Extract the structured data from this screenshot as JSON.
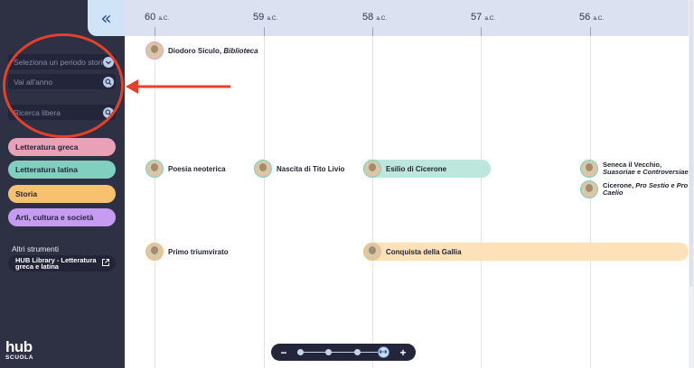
{
  "sidebar": {
    "collapse_icon": "double-chevron-left-icon",
    "period_select": {
      "placeholder": "Seleziona un periodo storico",
      "icon": "chevron-down-icon"
    },
    "year_input": {
      "placeholder": "Vai all'anno",
      "icon": "search-icon"
    },
    "free_search": {
      "placeholder": "Ricerca libera",
      "icon": "search-icon"
    },
    "categories": [
      {
        "label": "Letteratura greca",
        "color": "#e8a1b7"
      },
      {
        "label": "Letteratura latina",
        "color": "#7fd0bf"
      },
      {
        "label": "Storia",
        "color": "#f7c270"
      },
      {
        "label": "Arti, cultura e società",
        "color": "#c79bf1"
      }
    ],
    "tools_label": "Altri strumenti",
    "hub_link": {
      "label": "HUB Library - Letteratura greca e latina",
      "icon": "external-link-icon"
    },
    "logo": {
      "main": "hub",
      "sub": "SCUOLA"
    }
  },
  "timeline": {
    "years": [
      {
        "value": "60",
        "era": "a.C."
      },
      {
        "value": "59",
        "era": "a.C."
      },
      {
        "value": "58",
        "era": "a.C."
      },
      {
        "value": "57",
        "era": "a.C."
      },
      {
        "value": "56",
        "era": "a.C."
      }
    ],
    "events": {
      "diodoro": {
        "author": "Diodoro Siculo, ",
        "work": "Biblioteca"
      },
      "poesia": "Poesia neoterica",
      "tito_livio": "Nascita di Tito Livio",
      "esilio": "Esilio di Cicerone",
      "seneca": {
        "author": "Seneca il Vecchio, ",
        "work1": "Suasoriae",
        "mid": " e ",
        "work2": "Controversiae"
      },
      "cicerone": {
        "author": "Cicerone, ",
        "work1": "Pro Sestio",
        "mid": " e ",
        "work2": "Pro Caelio"
      },
      "triumvirato": "Primo triumvirato",
      "gallia": "Conquista della Gallia"
    },
    "colors": {
      "latina_bar": "#bde6dc",
      "storia_bar": "#fde1b9"
    }
  },
  "zoom": {
    "minus": "−",
    "plus": "+",
    "handle_icon": "resize-horizontal-icon"
  }
}
